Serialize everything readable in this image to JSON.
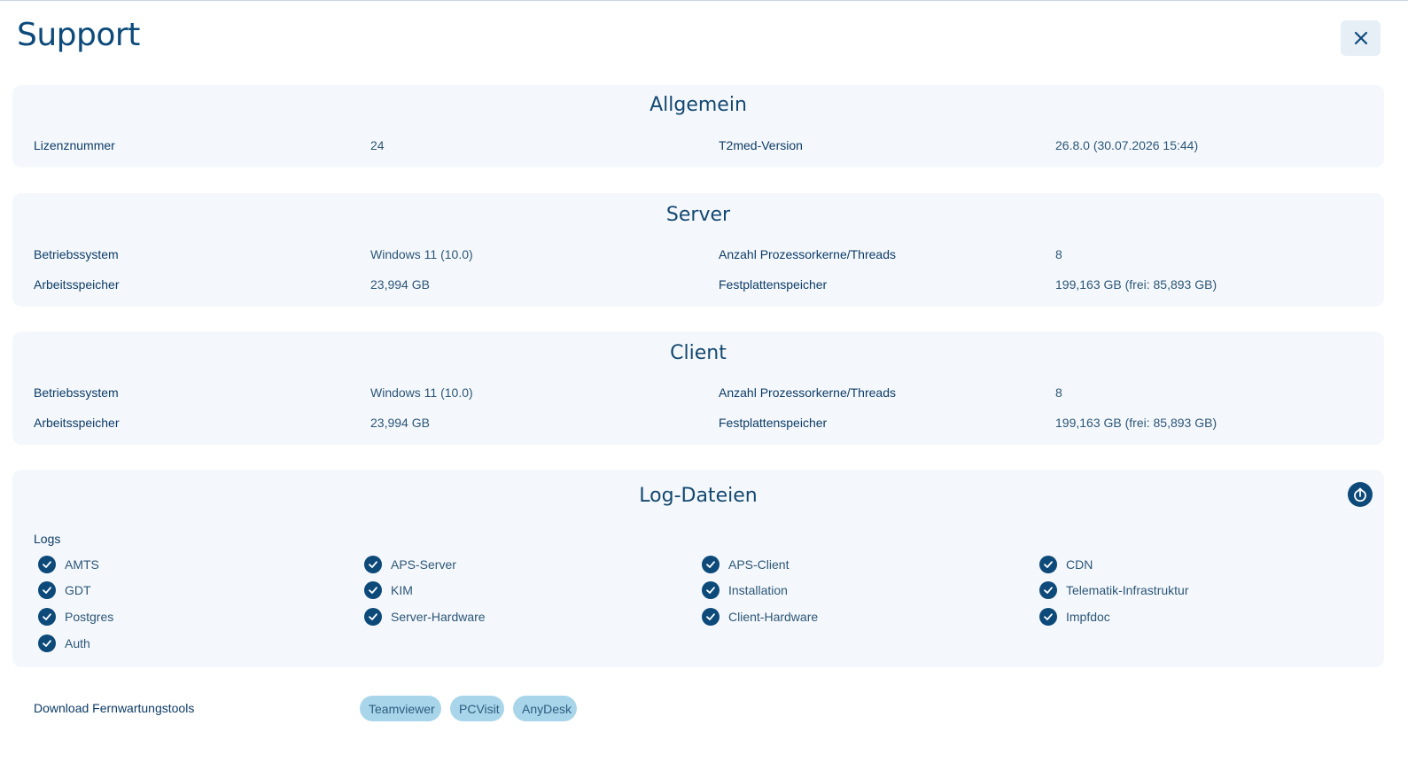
{
  "page": {
    "title": "Support"
  },
  "allgemein": {
    "title": "Allgemein",
    "license_label": "Lizenznummer",
    "license_value": "24",
    "version_label": "T2med-Version",
    "version_value": "26.8.0 (30.07.2026 15:44)"
  },
  "server": {
    "title": "Server",
    "os_label": "Betriebssystem",
    "os_value": "Windows 11 (10.0)",
    "cores_label": "Anzahl Prozessorkerne/Threads",
    "cores_value": "8",
    "ram_label": "Arbeitsspeicher",
    "ram_value": "23,994 GB",
    "disk_label": "Festplattenspeicher",
    "disk_value": "199,163 GB (frei: 85,893 GB)"
  },
  "client": {
    "title": "Client",
    "os_label": "Betriebssystem",
    "os_value": "Windows 11 (10.0)",
    "cores_label": "Anzahl Prozessorkerne/Threads",
    "cores_value": "8",
    "ram_label": "Arbeitsspeicher",
    "ram_value": "23,994 GB",
    "disk_label": "Festplattenspeicher",
    "disk_value": "199,163 GB (frei: 85,893 GB)"
  },
  "logs": {
    "title": "Log-Dateien",
    "subtitle": "Logs",
    "items": [
      {
        "label": "AMTS",
        "checked": true
      },
      {
        "label": "GDT",
        "checked": true
      },
      {
        "label": "Postgres",
        "checked": true
      },
      {
        "label": "Auth",
        "checked": true
      },
      {
        "label": "APS-Server",
        "checked": true
      },
      {
        "label": "KIM",
        "checked": true
      },
      {
        "label": "Server-Hardware",
        "checked": true
      },
      {
        "label": "APS-Client",
        "checked": true
      },
      {
        "label": "Installation",
        "checked": true
      },
      {
        "label": "Client-Hardware",
        "checked": true
      },
      {
        "label": "CDN",
        "checked": true
      },
      {
        "label": "Telematik-Infrastruktur",
        "checked": true
      },
      {
        "label": "Impfdoc",
        "checked": true
      }
    ]
  },
  "download": {
    "label": "Download Fernwartungstools",
    "tools": [
      "Teamviewer",
      "PCVisit",
      "AnyDesk"
    ]
  },
  "icons": {
    "close": "close-icon",
    "upload": "upload-icon",
    "check": "check-icon"
  },
  "colors": {
    "primary": "#0d4a7a",
    "card_bg": "#f4f8fc",
    "pill_bg": "#a9d5ea"
  }
}
